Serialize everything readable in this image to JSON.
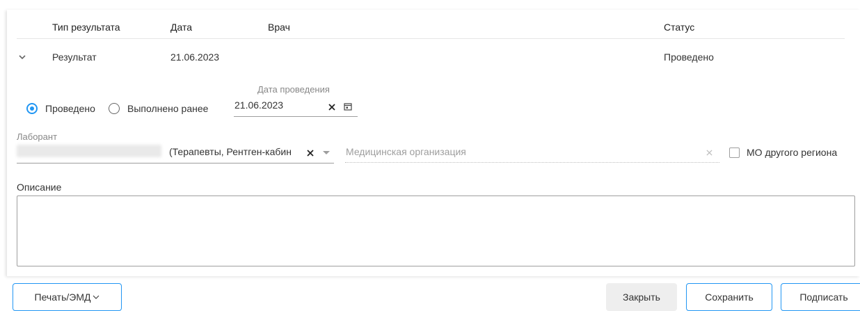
{
  "table": {
    "headers": {
      "type": "Тип результата",
      "date": "Дата",
      "doctor": "Врач",
      "status": "Статус"
    },
    "row": {
      "type": "Результат",
      "date": "21.06.2023",
      "status": "Проведено"
    }
  },
  "form": {
    "radio_done": "Проведено",
    "radio_earlier": "Выполнено ранее",
    "radio_selected": "Проведено",
    "date_label": "Дата проведения",
    "date_value": "21.06.2023",
    "lab_label": "Лаборант",
    "lab_value": "(Терапевты, Рентген-кабин",
    "org_placeholder": "Медицинская организация",
    "other_region_label": "МО другого региона",
    "other_region_checked": false,
    "description_label": "Описание",
    "description_value": ""
  },
  "footer": {
    "print_label": "Печать/ЭМД",
    "close_label": "Закрыть",
    "save_label": "Сохранить",
    "sign_label": "Подписать"
  },
  "colors": {
    "accent": "#2196f3",
    "border": "#9e9e9e"
  }
}
